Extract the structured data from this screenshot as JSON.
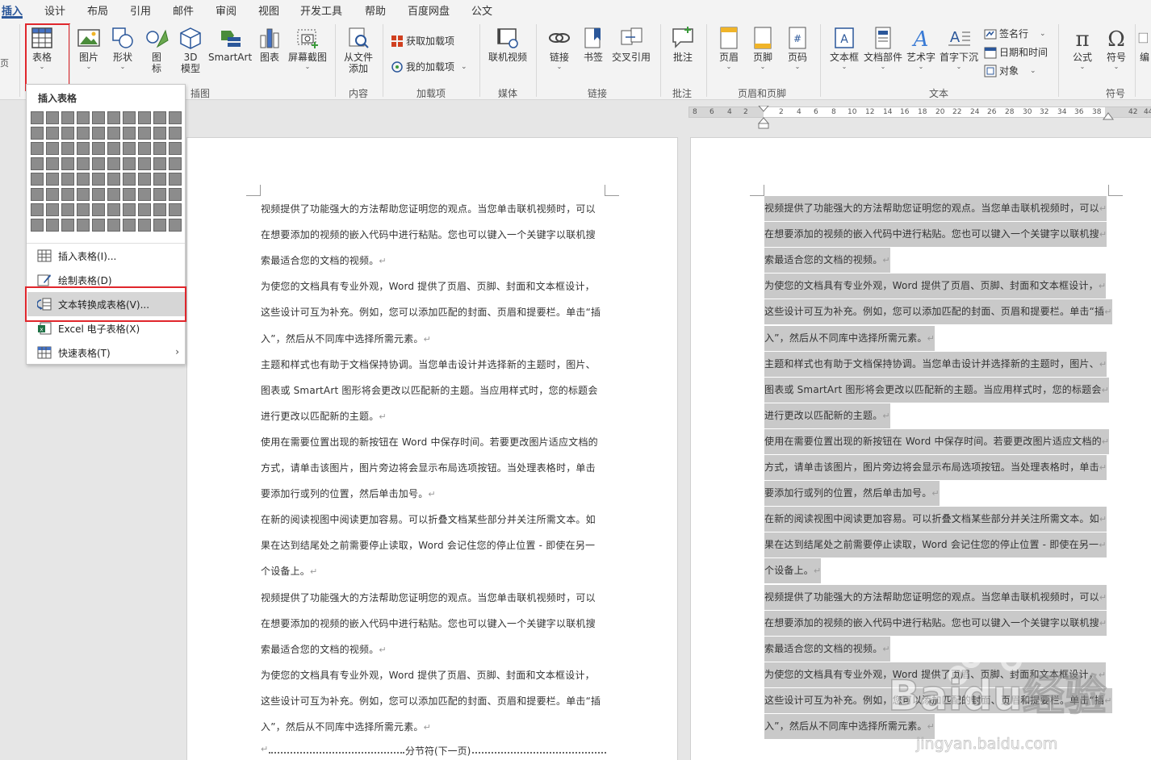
{
  "tabs": [
    "插入",
    "设计",
    "布局",
    "引用",
    "邮件",
    "审阅",
    "视图",
    "开发工具",
    "帮助",
    "百度网盘",
    "公文"
  ],
  "ribbon": {
    "table_btn": "表格",
    "picture_btn": "图片",
    "shape_btn": "形状",
    "icon_btn_l1": "图",
    "icon_btn_l2": "标",
    "model3d_l1": "3D",
    "model3d_l2": "模型",
    "smartart_btn": "SmartArt",
    "chart_btn": "图表",
    "screenshot_btn": "屏幕截图",
    "addin_file_l1": "从文件",
    "addin_file_l2": "添加",
    "get_addins": "获取加载项",
    "my_addins": "我的加载项",
    "online_video": "联机视频",
    "link_btn": "链接",
    "bookmark_btn": "书签",
    "crossref_btn": "交叉引用",
    "comment_btn": "批注",
    "header_btn": "页眉",
    "footer_btn": "页脚",
    "pagenum_btn": "页码",
    "textbox_btn": "文本框",
    "docparts_btn": "文档部件",
    "wordart_btn": "艺术字",
    "dropcap_btn": "首字下沉",
    "signature_btn": "签名行",
    "datetime_btn": "日期和时间",
    "object_btn": "对象",
    "equation_btn": "公式",
    "symbol_btn": "符号",
    "edit_btn": "编",
    "groups": {
      "illustrations": "插图",
      "content": "内容",
      "addins": "加载项",
      "media": "媒体",
      "links": "链接",
      "comments": "批注",
      "header_footer": "页眉和页脚",
      "text": "文本",
      "symbols": "符号"
    }
  },
  "left_edge_text": "页",
  "ruler_labels": [
    "8",
    "6",
    "4",
    "2",
    "2",
    "4",
    "6",
    "8",
    "10",
    "12",
    "14",
    "16",
    "18",
    "20",
    "22",
    "24",
    "26",
    "28",
    "30",
    "32",
    "34",
    "36",
    "38",
    "42",
    "44"
  ],
  "dropdown": {
    "title": "插入表格",
    "items": [
      {
        "label": "插入表格(I)..."
      },
      {
        "label": "绘制表格(D)"
      },
      {
        "label": "文本转换成表格(V)..."
      },
      {
        "label": "Excel 电子表格(X)"
      },
      {
        "label": "快速表格(T)"
      }
    ]
  },
  "document": {
    "lines": [
      "视频提供了功能强大的方法帮助您证明您的观点。当您单击联机视频时，可以",
      "在想要添加的视频的嵌入代码中进行粘贴。您也可以键入一个关键字以联机搜",
      "索最适合您的文档的视频。",
      "为使您的文档具有专业外观，Word 提供了页眉、页脚、封面和文本框设计，",
      "这些设计可互为补充。例如，您可以添加匹配的封面、页眉和提要栏。单击“插",
      "入”，然后从不同库中选择所需元素。",
      "主题和样式也有助于文档保持协调。当您单击设计并选择新的主题时，图片、",
      "图表或 SmartArt 图形将会更改以匹配新的主题。当应用样式时，您的标题会",
      "进行更改以匹配新的主题。",
      "使用在需要位置出现的新按钮在 Word 中保存时间。若要更改图片适应文档的",
      "方式，请单击该图片，图片旁边将会显示布局选项按钮。当处理表格时，单击",
      "要添加行或列的位置，然后单击加号。",
      "在新的阅读视图中阅读更加容易。可以折叠文档某些部分并关注所需文本。如",
      "果在达到结尾处之前需要停止读取，Word 会记住您的停止位置 - 即使在另一",
      "个设备上。",
      "视频提供了功能强大的方法帮助您证明您的观点。当您单击联机视频时，可以",
      "在想要添加的视频的嵌入代码中进行粘贴。您也可以键入一个关键字以联机搜",
      "索最适合您的文档的视频。",
      "为使您的文档具有专业外观，Word 提供了页眉、页脚、封面和文本框设计，",
      "这些设计可互为补充。例如，您可以添加匹配的封面、页眉和提要栏。单击“插",
      "入”，然后从不同库中选择所需元素。"
    ],
    "paragraph_mark": "↵",
    "section_break": "分节符(下一页)"
  },
  "watermark": {
    "brand": "Baidu经验",
    "url": "jingyan.baidu.com"
  },
  "colors": {
    "accent": "#2b579a",
    "highlight_border": "#e0262c",
    "selection": "#c9c9c9"
  }
}
